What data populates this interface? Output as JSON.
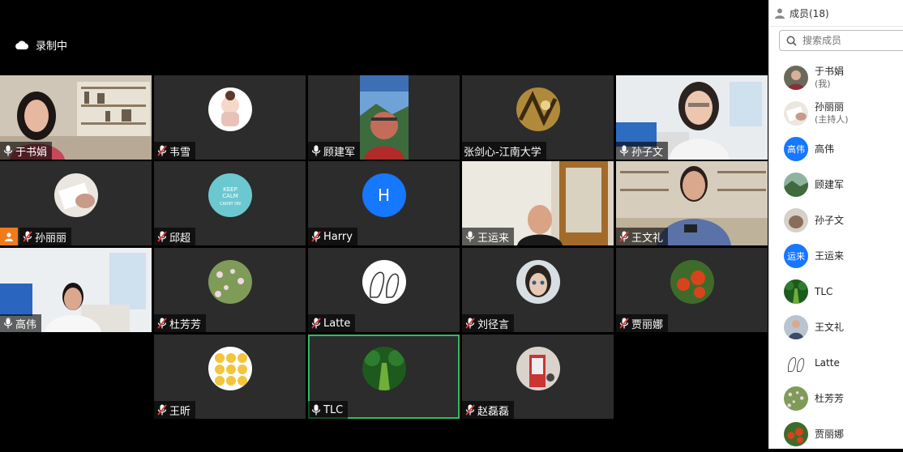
{
  "recording": {
    "label": "录制中"
  },
  "grid": [
    {
      "name": "于书娟",
      "mic": "on",
      "kind": "video",
      "bg": "office-woman"
    },
    {
      "name": "韦雪",
      "mic": "muted",
      "kind": "avatar",
      "bg": "girl-cartoon"
    },
    {
      "name": "顾建军",
      "mic": "on",
      "kind": "video",
      "bg": "man-landscape"
    },
    {
      "name": "张剑心-江南大学",
      "mic": "none",
      "kind": "avatar",
      "bg": "gold-art"
    },
    {
      "name": "孙子文",
      "mic": "on",
      "kind": "video",
      "bg": "blue-room-woman"
    },
    {
      "name": "孙丽丽",
      "mic": "muted",
      "kind": "avatar",
      "bg": "hand-book",
      "host": true
    },
    {
      "name": "邱超",
      "mic": "muted",
      "kind": "avatar",
      "bg": "keep-calm"
    },
    {
      "name": "Harry",
      "mic": "muted",
      "kind": "initial",
      "initial": "H"
    },
    {
      "name": "王运来",
      "mic": "on",
      "kind": "video",
      "bg": "room-man"
    },
    {
      "name": "王文礼",
      "mic": "muted",
      "kind": "video",
      "bg": "office-man-phone"
    },
    {
      "name": "高伟",
      "mic": "on",
      "kind": "video",
      "bg": "blue-room-man"
    },
    {
      "name": "杜芳芳",
      "mic": "muted",
      "kind": "avatar",
      "bg": "flowers"
    },
    {
      "name": "Latte",
      "mic": "muted",
      "kind": "avatar",
      "bg": "sketch"
    },
    {
      "name": "刘径言",
      "mic": "muted",
      "kind": "avatar",
      "bg": "doll"
    },
    {
      "name": "贾丽娜",
      "mic": "muted",
      "kind": "avatar",
      "bg": "tomatoes"
    },
    {
      "name": "王昕",
      "mic": "muted",
      "kind": "avatar",
      "bg": "emoji"
    },
    {
      "name": "TLC",
      "mic": "on",
      "kind": "avatar",
      "bg": "forest",
      "active": true
    },
    {
      "name": "赵磊磊",
      "mic": "muted",
      "kind": "avatar",
      "bg": "booth"
    }
  ],
  "panel": {
    "title": "成员(18)",
    "search_placeholder": "搜索成员",
    "members": [
      {
        "name": "于书娟",
        "sub": "(我)",
        "av": "photo1"
      },
      {
        "name": "孙丽丽",
        "sub": "(主持人)",
        "av": "hand-book"
      },
      {
        "name": "高伟",
        "av": "text",
        "text": "高伟",
        "color": "#1677ff"
      },
      {
        "name": "顾建军",
        "av": "landscape"
      },
      {
        "name": "孙子文",
        "av": "cat"
      },
      {
        "name": "王运来",
        "av": "text",
        "text": "运来",
        "color": "#1677ff"
      },
      {
        "name": "TLC",
        "av": "forest"
      },
      {
        "name": "王文礼",
        "av": "man"
      },
      {
        "name": "Latte",
        "av": "sketch"
      },
      {
        "name": "杜芳芳",
        "av": "flowers"
      },
      {
        "name": "贾丽娜",
        "av": "tomatoes"
      }
    ]
  }
}
